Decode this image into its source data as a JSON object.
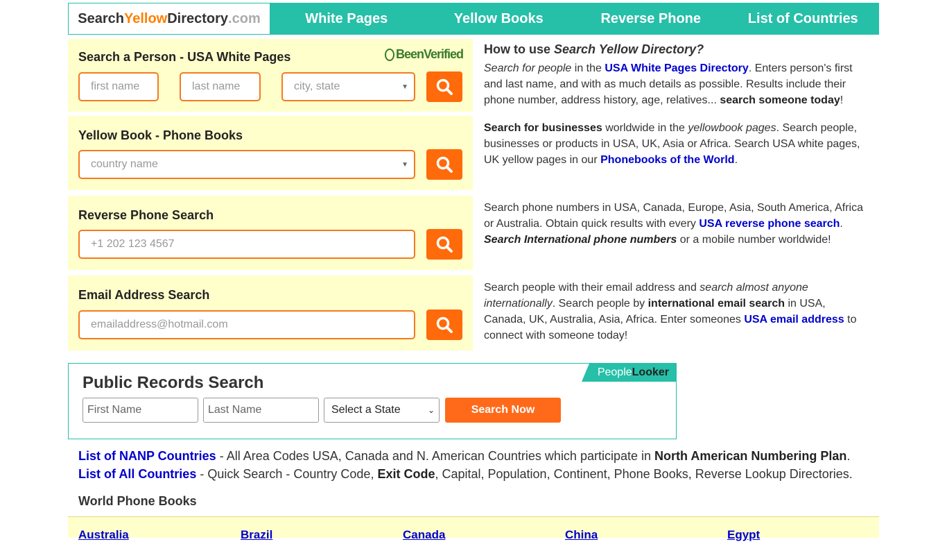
{
  "nav": {
    "logo": {
      "part1": "Search",
      "part2": "Yellow",
      "part3": "Directory",
      "part4": ".com"
    },
    "items": [
      "White Pages",
      "Yellow Books",
      "Reverse Phone",
      "List of Countries"
    ]
  },
  "white_pages": {
    "title": "Search a Person - USA White Pages",
    "badge": "BeenVerified",
    "first_placeholder": "first name",
    "last_placeholder": "last name",
    "city_placeholder": "city, state"
  },
  "yellow_book": {
    "title": "Yellow Book - Phone Books",
    "country_placeholder": "country name"
  },
  "reverse_phone": {
    "title": "Reverse Phone Search",
    "phone_placeholder": "+1 202 123 4567"
  },
  "email": {
    "title": "Email Address Search",
    "email_placeholder": "emailaddress@hotmail.com"
  },
  "howto": {
    "title_plain": "How to use ",
    "title_italic": "Search Yellow Directory?",
    "p1": {
      "i1": "Search for people",
      "t1": " in the ",
      "link": "USA White Pages Directory",
      "t2": ". Enters person's first and last name, and with as much details as possible. Results include their phone number, address history, age, relatives... ",
      "b1": "search someone today",
      "t3": "!"
    },
    "p2": {
      "b1": "Search for businesses",
      "t1": " worldwide in the ",
      "i1": "yellowbook pages",
      "t2": ". Search people, businesses or products in USA, UK, Asia or Africa. Search USA white pages, UK yellow pages in our ",
      "link": "Phonebooks of the World",
      "t3": "."
    },
    "p3": {
      "t1": "Search phone numbers in USA, Canada, Europe, Asia, South America, Africa or Australia. Obtain quick results with every ",
      "link": "USA reverse phone search",
      "t2": ". ",
      "bi": "Search International phone numbers",
      "t3": " or a mobile number worldwide!"
    },
    "p4": {
      "t1": "Search people with their email address and ",
      "i1": "search almost anyone internationally",
      "t2": ". Search people by ",
      "b1": "international email search",
      "t3": " in USA, Canada, UK, Australia, Asia, Africa. Enter someones ",
      "link": "USA email address",
      "t4": " to connect with someone today!"
    }
  },
  "public_records": {
    "title": "Public Records Search",
    "badge_a": "People",
    "badge_b": "Looker",
    "first_placeholder": "First Name",
    "last_placeholder": "Last Name",
    "state_selected": "Select a State",
    "button": "Search Now"
  },
  "links": {
    "nanp_link": "List of NANP Countries",
    "nanp_text1": " - All Area Codes USA, Canada and N. American Countries which participate in ",
    "nanp_bold": "North American Numbering Plan",
    "nanp_text2": ".",
    "all_link": "List of All Countries",
    "all_text1": " - Quick Search - Country Code, ",
    "all_bold": "Exit Code",
    "all_text2": ", Capital, Population, Continent, Phone Books, Reverse Lookup Directories."
  },
  "world_phone_books": {
    "title": "World Phone Books",
    "countries": [
      "Australia",
      "Brazil",
      "Canada",
      "China",
      "Egypt"
    ]
  }
}
